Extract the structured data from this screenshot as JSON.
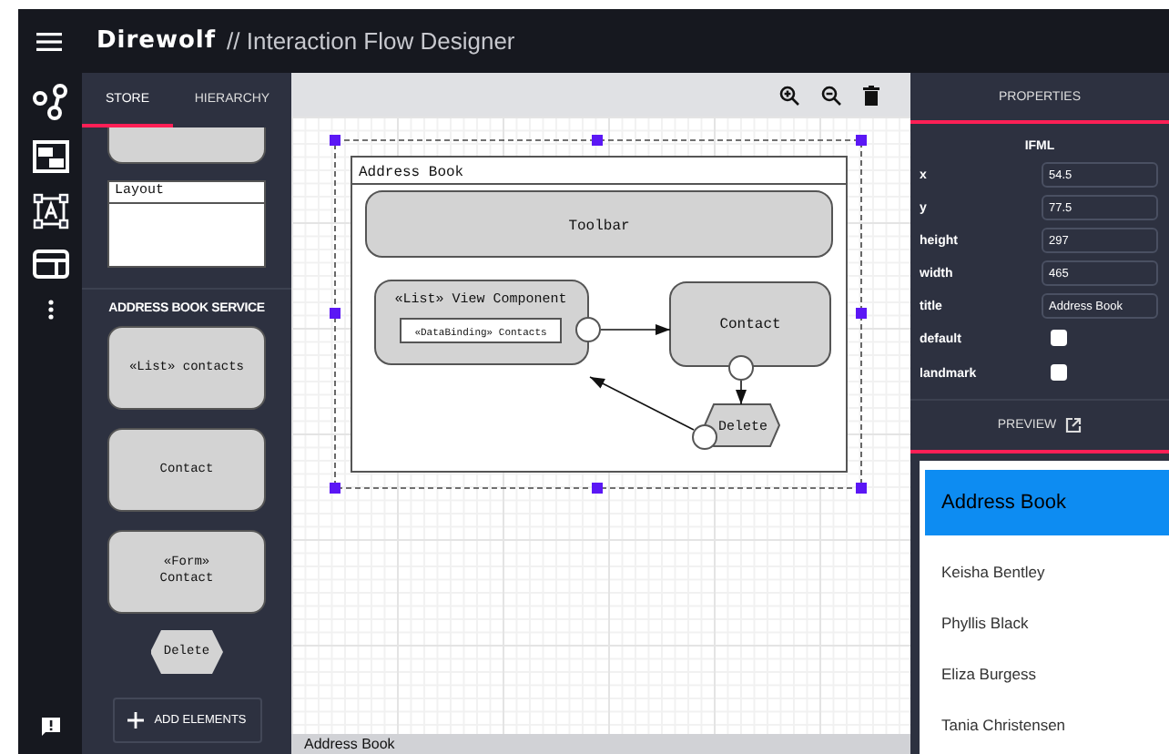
{
  "app": {
    "logo": "Direwolf",
    "title": "// Interaction Flow Designer"
  },
  "left_panel": {
    "tabs": [
      {
        "label": "STORE",
        "selected": true
      },
      {
        "label": "HIERARCHY",
        "selected": false
      }
    ],
    "layout_item": {
      "kind": "frame",
      "label": "Layout"
    },
    "section_title": "ADDRESS BOOK SERVICE",
    "items": [
      {
        "kind": "box",
        "lines": [
          "«List» contacts"
        ]
      },
      {
        "kind": "box",
        "lines": [
          "Contact"
        ]
      },
      {
        "kind": "box",
        "lines": [
          "«Form»",
          "Contact"
        ]
      },
      {
        "kind": "hexagon",
        "lines": [
          "Delete"
        ]
      }
    ],
    "add_button": "ADD ELEMENTS"
  },
  "canvas": {
    "frame_title": "Address Book",
    "toolbar_label": "Toolbar",
    "list_title": "«List» View Component",
    "binding": "«DataBinding» Contacts",
    "contact": "Contact",
    "delete": "Delete",
    "status": "Address Book"
  },
  "properties": {
    "tab": "PROPERTIES",
    "section": "IFML",
    "fields": [
      {
        "kind": "text",
        "label": "x",
        "value": "54.5"
      },
      {
        "kind": "text",
        "label": "y",
        "value": "77.5"
      },
      {
        "kind": "text",
        "label": "height",
        "value": "297"
      },
      {
        "kind": "text",
        "label": "width",
        "value": "465"
      },
      {
        "kind": "text",
        "label": "title",
        "value": "Address Book"
      },
      {
        "kind": "checkbox",
        "label": "default",
        "checked": false
      },
      {
        "kind": "checkbox",
        "label": "landmark",
        "checked": false
      }
    ],
    "preview_button": "PREVIEW"
  },
  "preview": {
    "title": "Address Book",
    "items": [
      "Keisha Bentley",
      "Phyllis Black",
      "Eliza Burgess",
      "Tania Christensen"
    ]
  }
}
